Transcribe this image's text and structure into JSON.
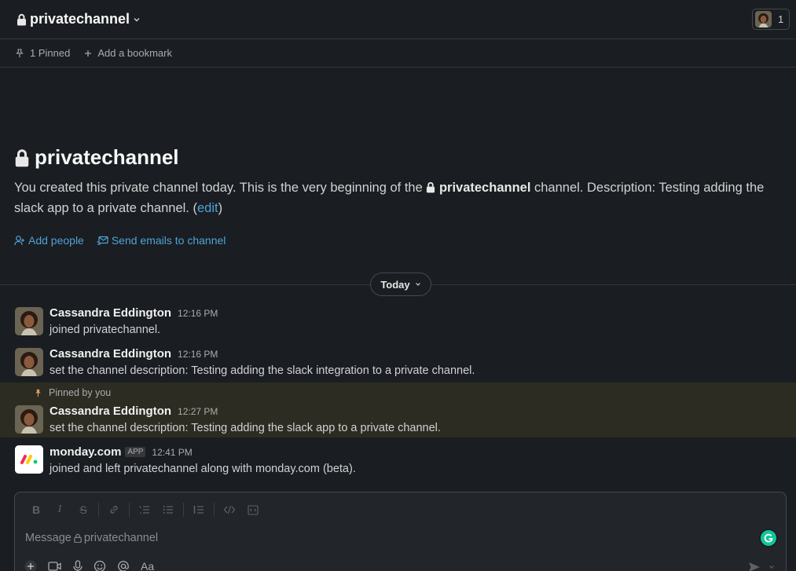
{
  "header": {
    "channel_name": "privatechannel",
    "member_count": "1"
  },
  "bookmarks": {
    "pinned_label": "1 Pinned",
    "add_label": "Add a bookmark"
  },
  "intro": {
    "title": "privatechannel",
    "desc_before": "You created this private channel today. This is the very beginning of the ",
    "desc_channel": "privatechannel",
    "desc_after": " channel. Description: Testing adding the slack app to a private channel. (",
    "edit_label": "edit",
    "desc_close": ")",
    "add_people": "Add people",
    "send_emails": "Send emails to channel"
  },
  "divider": {
    "label": "Today"
  },
  "messages": [
    {
      "author": "Cassandra Eddington",
      "time": "12:16 PM",
      "text": "joined privatechannel."
    },
    {
      "author": "Cassandra Eddington",
      "time": "12:16 PM",
      "text": "set the channel description: Testing adding the slack integration to a private channel."
    },
    {
      "pinned_label": "Pinned by you",
      "author": "Cassandra Eddington",
      "time": "12:27 PM",
      "text": "set the channel description: Testing adding the slack app to a private channel."
    },
    {
      "author": "monday.com",
      "badge": "APP",
      "time": "12:41 PM",
      "text": "joined and left privatechannel along with monday.com (beta)."
    }
  ],
  "composer": {
    "placeholder_prefix": "Message ",
    "placeholder_channel": "privatechannel",
    "format_label": "Aa"
  },
  "colors": {
    "background": "#1a1d21",
    "link": "#4fa3d8",
    "pinned_highlight": "#2d2c22",
    "grammarly": "#15c39a"
  }
}
